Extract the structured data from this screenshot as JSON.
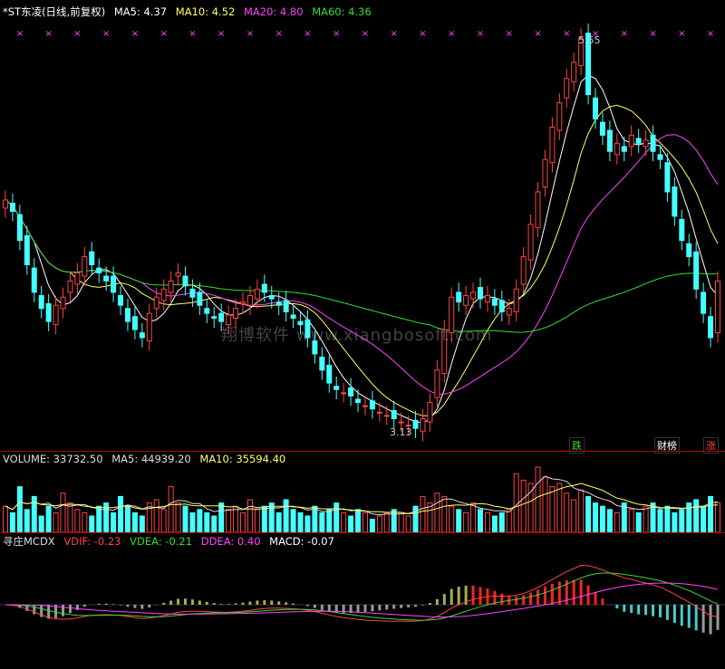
{
  "price_panel": {
    "stock_name": "*ST东凌(日线,前复权)",
    "indicators": [
      {
        "label": "MA5: 4.37",
        "color": "#ffffff"
      },
      {
        "label": "MA10: 4.52",
        "color": "#ffff66"
      },
      {
        "label": "MA20: 4.80",
        "color": "#ff44ff"
      },
      {
        "label": "MA60: 4.36",
        "color": "#33dd33"
      }
    ],
    "high_label": "5.55",
    "low_label": "3.13",
    "watermark": "翔博软件 www.xiangbosoft.com",
    "tags": [
      {
        "text": "跌",
        "color": "#33dd33"
      },
      {
        "text": "财榜",
        "color": "#ffffff"
      },
      {
        "text": "涨",
        "color": "#ff4444"
      }
    ]
  },
  "volume_panel": {
    "indicators": [
      {
        "label": "VOLUME: 33732.50",
        "color": "#dddddd"
      },
      {
        "label": "MA5: 44939.20",
        "color": "#dddddd"
      },
      {
        "label": "MA10: 35594.40",
        "color": "#ffff66"
      }
    ]
  },
  "macd_panel": {
    "name": "寻庄MCDX",
    "indicators": [
      {
        "label": "VDIF: -0.23",
        "color": "#ff4444"
      },
      {
        "label": "VDEA: -0.21",
        "color": "#33dd33"
      },
      {
        "label": "DDEA: 0.40",
        "color": "#ff44ff"
      },
      {
        "label": "MACD: -0.07",
        "color": "#ffffff"
      }
    ]
  },
  "chart_data": {
    "type": "candlestick",
    "price_range": [
      3.13,
      5.55
    ],
    "closes": [
      4.55,
      4.48,
      4.3,
      4.15,
      3.98,
      3.88,
      3.8,
      3.9,
      3.95,
      4.05,
      4.1,
      4.2,
      4.15,
      4.1,
      4.05,
      3.98,
      3.9,
      3.8,
      3.75,
      3.7,
      3.85,
      3.95,
      4.0,
      4.05,
      4.1,
      4.02,
      3.95,
      3.9,
      3.85,
      3.82,
      3.8,
      3.84,
      3.88,
      3.92,
      3.96,
      4.0,
      3.98,
      3.94,
      3.9,
      3.86,
      3.82,
      3.78,
      3.7,
      3.6,
      3.5,
      3.42,
      3.38,
      3.36,
      3.34,
      3.3,
      3.28,
      3.26,
      3.24,
      3.22,
      3.2,
      3.18,
      3.16,
      3.14,
      3.2,
      3.3,
      3.5,
      3.75,
      3.95,
      3.92,
      3.96,
      3.98,
      3.94,
      3.96,
      3.9,
      3.86,
      3.88,
      4.0,
      4.2,
      4.4,
      4.6,
      4.8,
      5.0,
      5.15,
      5.3,
      5.4,
      5.55,
      5.2,
      5.05,
      4.95,
      4.85,
      4.9,
      4.85,
      4.95,
      4.9,
      4.92,
      4.85,
      4.8,
      4.6,
      4.45,
      4.3,
      4.2,
      4.0,
      3.85,
      3.7,
      4.05
    ],
    "volumes": [
      40,
      30,
      70,
      35,
      55,
      25,
      40,
      30,
      60,
      45,
      35,
      30,
      25,
      40,
      45,
      30,
      55,
      40,
      30,
      25,
      45,
      50,
      35,
      70,
      45,
      40,
      30,
      35,
      30,
      25,
      45,
      35,
      40,
      30,
      50,
      35,
      40,
      45,
      30,
      50,
      35,
      30,
      25,
      40,
      30,
      35,
      45,
      30,
      25,
      35,
      30,
      20,
      25,
      30,
      35,
      30,
      25,
      40,
      55,
      45,
      60,
      55,
      40,
      35,
      30,
      45,
      35,
      30,
      25,
      30,
      35,
      90,
      80,
      75,
      100,
      85,
      70,
      75,
      60,
      50,
      65,
      55,
      45,
      40,
      35,
      30,
      45,
      35,
      30,
      40,
      45,
      35,
      40,
      30,
      35,
      45,
      50,
      40,
      55,
      45
    ],
    "ma_series": [
      "MA5",
      "MA10",
      "MA20",
      "MA60"
    ],
    "macd_series": [
      "VDIF",
      "VDEA",
      "DDEA",
      "MACD"
    ]
  }
}
